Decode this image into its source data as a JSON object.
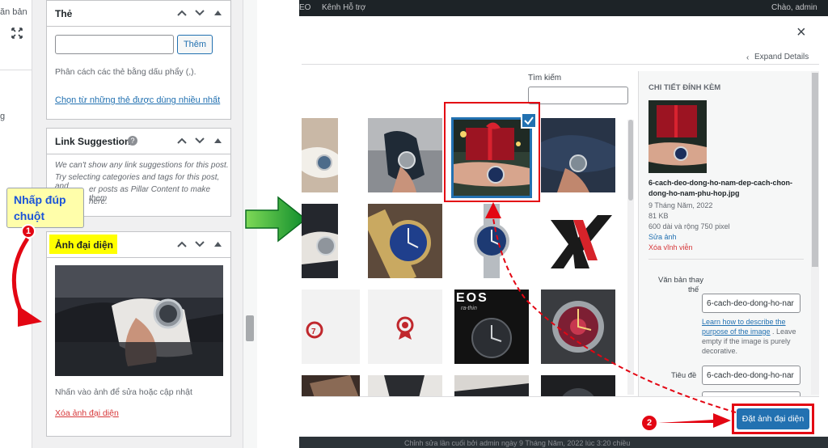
{
  "left_panel": {
    "strip_label_top": "ăn bản",
    "strip_label_mid": "g",
    "tags_box": {
      "title": "Thẻ",
      "add_button": "Thêm",
      "hint": "Phân cách các thẻ bằng dấu phẩy (,).",
      "choose_link": "Chọn từ những thẻ được dùng nhiều nhất"
    },
    "link_suggestions": {
      "title": "Link Suggestions",
      "line1": "We can't show any link suggestions for this post.",
      "line2": "Try selecting categories and tags for this post, and",
      "line3": "er posts as Pillar Content to make them",
      "line4": "here."
    },
    "featured_image": {
      "title": "Ảnh đại diện",
      "hint": "Nhấn vào ảnh để sửa hoặc cập nhật",
      "remove_link": "Xóa ảnh đại diện"
    }
  },
  "callout": {
    "line1": "Nhấp đúp",
    "line2": "chuột",
    "step1": "1",
    "step2": "2"
  },
  "topbar": {
    "left_fragment": "EO",
    "support": "Kênh Hỗ trợ",
    "greeting": "Chào, admin"
  },
  "modal": {
    "close_label": "×",
    "expand_details": "Expand Details",
    "search_label": "Tìm kiếm",
    "search_value": "",
    "grid_text_badge": "EOS",
    "grid_text_sub": "ra-thin",
    "details": {
      "heading": "CHI TIẾT ĐÍNH KÈM",
      "filename_line1": "6-cach-deo-dong-ho-nam-dep-cach-chon-",
      "filename_line2": "dong-ho-nam-phu-hop.jpg",
      "date": "9 Tháng Năm, 2022",
      "size": "81 KB",
      "dimensions": "600 dài và rộng 750 pixel",
      "edit_link": "Sửa ảnh",
      "delete_link": "Xóa vĩnh viễn",
      "alt_label_1": "Văn bản thay",
      "alt_label_2": "thế",
      "alt_value": "6-cach-deo-dong-ho-nar",
      "learn_link_1": "Learn how to describe the",
      "learn_link_2": "purpose of the image",
      "learn_rest_1": ". Leave",
      "learn_rest_2": "empty if the image is purely",
      "learn_rest_3": "decorative.",
      "title_label": "Tiêu đề",
      "title_value": "6-cach-deo-dong-ho-nar"
    },
    "set_button": "Đặt ảnh đại diện",
    "footer_text": "Chỉnh sửa lần cuối bởi admin ngày 9 Tháng Năm, 2022 lúc 3:20 chiều"
  },
  "colors": {
    "accent": "#2271b1",
    "annotation_red": "#e30613",
    "arrow_green": "#22b14c",
    "highlight_yellow": "#ffff00",
    "callout_blue": "#1b54d8"
  }
}
